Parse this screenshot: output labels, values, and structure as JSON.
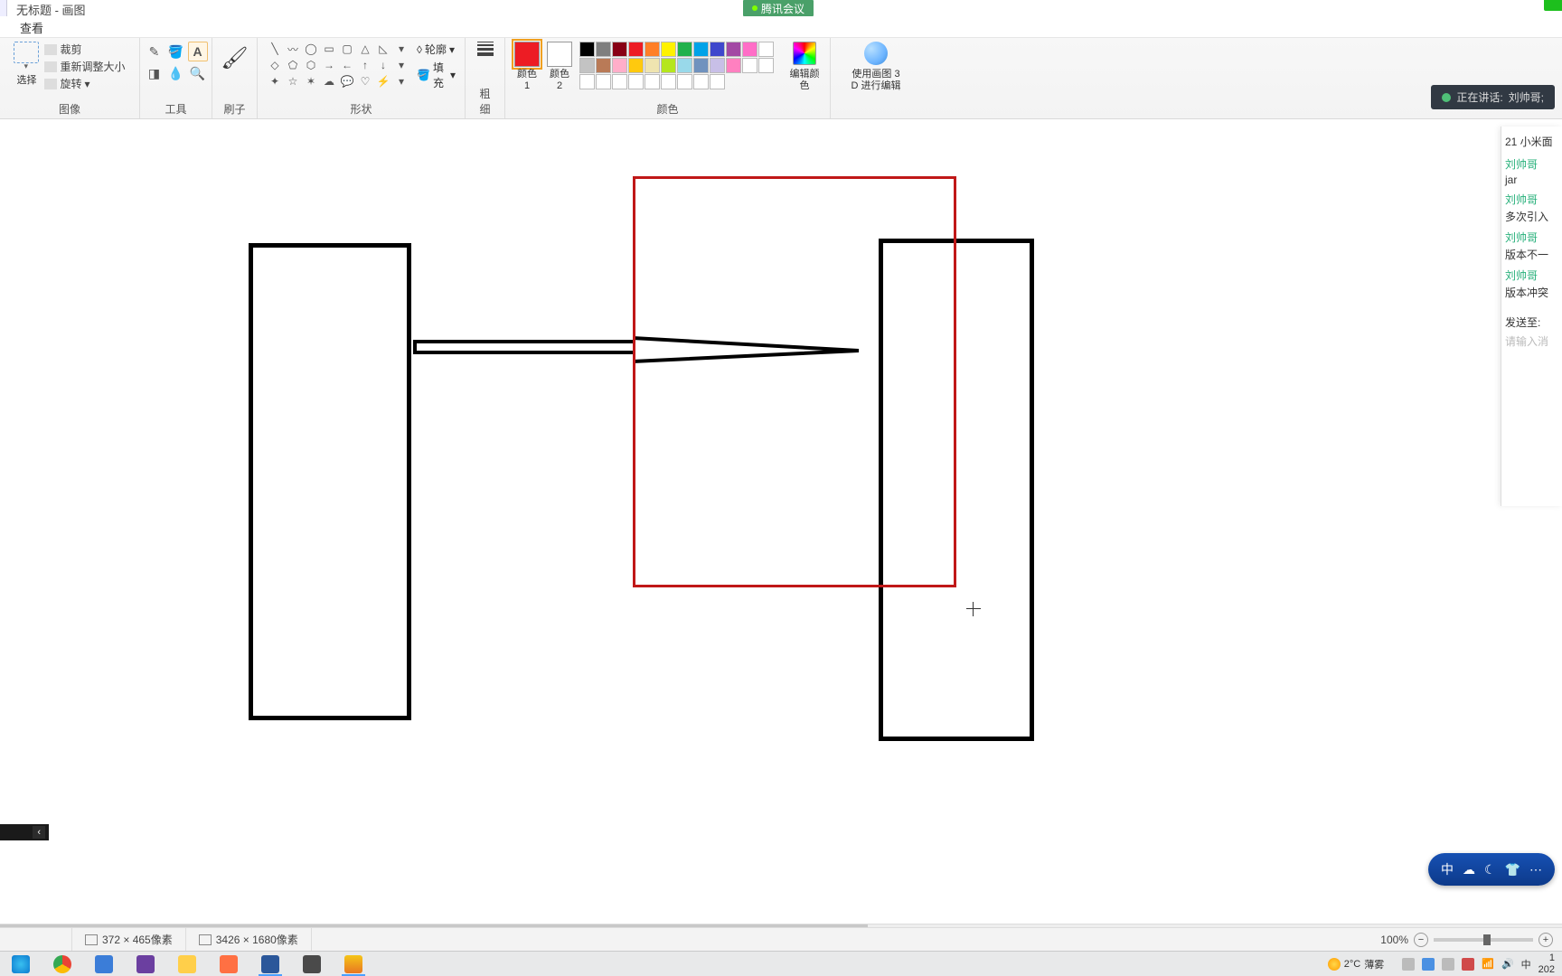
{
  "title": "无标题 - 画图",
  "meeting_badge": "腾讯会议",
  "menubar": {
    "view": "查看"
  },
  "ribbon": {
    "image": {
      "label": "图像",
      "select": "选择",
      "crop": "裁剪",
      "resize": "重新调整大小",
      "rotate": "旋转"
    },
    "tools": {
      "label": "工具"
    },
    "brushes": {
      "label": "刷子"
    },
    "shapes": {
      "label": "形状",
      "outline": "轮廓",
      "fill": "填充"
    },
    "thickness": {
      "label": "粗细"
    },
    "colors": {
      "label": "颜色",
      "c1": "颜色 1",
      "c2": "颜色 2",
      "edit": "编辑颜色"
    },
    "paint3d": {
      "l1": "使用画图 3",
      "l2": "D 进行编辑"
    }
  },
  "speaking": {
    "label": "正在讲话:",
    "name": "刘帅哥;"
  },
  "chat": {
    "header": "21 小米面",
    "items": [
      {
        "name": "刘帅哥",
        "msg": "jar"
      },
      {
        "name": "刘帅哥",
        "msg": "多次引入"
      },
      {
        "name": "刘帅哥",
        "msg": "版本不一"
      },
      {
        "name": "刘帅哥",
        "msg": "版本冲突"
      }
    ],
    "send_label": "发送至:",
    "placeholder": "请输入消"
  },
  "dock_chevron": "‹",
  "status": {
    "selection": "372 × 465像素",
    "canvas": "3426 × 1680像素",
    "zoom": "100%"
  },
  "taskbar": {
    "weather_temp": "2°C",
    "weather_desc": "薄雾",
    "lang": "中",
    "time": "1",
    "date": "202"
  },
  "palette_row1": [
    "#000000",
    "#7f7f7f",
    "#880015",
    "#ed1c24",
    "#ff7f27",
    "#fff200",
    "#22b14c",
    "#00a2e8",
    "#3f48cc",
    "#a349a4",
    "#ff6ec7"
  ],
  "palette_row2": [
    "#ffffff",
    "#c3c3c3",
    "#b97a57",
    "#ffaec9",
    "#ffc90e",
    "#efe4b0",
    "#b5e61d",
    "#99d9ea",
    "#7092be",
    "#c8bfe7",
    "#ff80c0"
  ],
  "palette_row3": [
    "#ffffff",
    "#ffffff",
    "#ffffff",
    "#ffffff",
    "#ffffff",
    "#ffffff",
    "#ffffff",
    "#ffffff",
    "#ffffff",
    "#ffffff",
    "#ffffff"
  ]
}
